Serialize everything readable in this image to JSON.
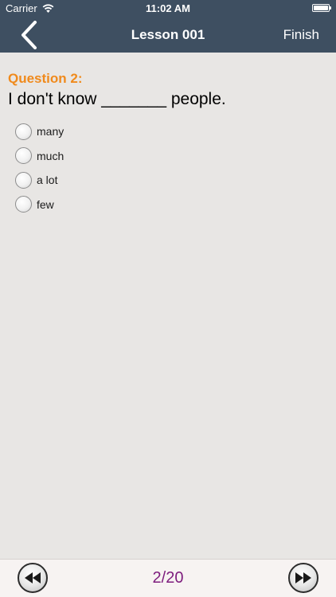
{
  "status_bar": {
    "carrier": "Carrier",
    "time": "11:02 AM"
  },
  "nav": {
    "title": "Lesson 001",
    "finish_label": "Finish"
  },
  "question": {
    "label": "Question 2:",
    "text": "I don't know _______ people.",
    "options": [
      {
        "label": "many"
      },
      {
        "label": "much"
      },
      {
        "label": "a lot"
      },
      {
        "label": "few"
      }
    ]
  },
  "footer": {
    "page_counter": "2/20"
  },
  "colors": {
    "bar_background": "#3e4f61",
    "question_label": "#f08a1c",
    "page_counter": "#7d1c7d",
    "content_background": "#e8e6e4"
  },
  "icons": {
    "back": "chevron-left-icon",
    "prev": "rewind-icon",
    "next": "fast-forward-icon",
    "wifi": "wifi-icon",
    "battery": "battery-icon"
  }
}
